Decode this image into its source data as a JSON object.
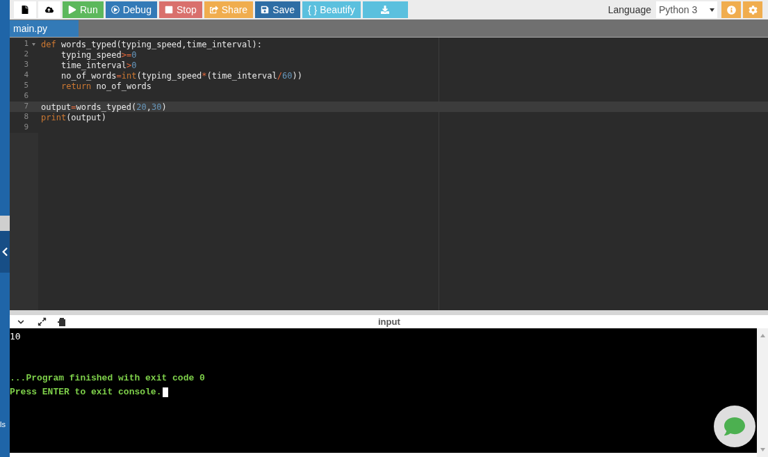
{
  "toolbar": {
    "buttons": [
      {
        "kind": "new-file",
        "color": "#ffffff"
      },
      {
        "kind": "upload",
        "color": "#ffffff"
      },
      {
        "kind": "run",
        "label": "Run",
        "color": "#5cb85c"
      },
      {
        "kind": "debug",
        "label": "Debug",
        "color": "#337ab7"
      },
      {
        "kind": "stop",
        "label": "Stop",
        "color": "#d9706c"
      },
      {
        "kind": "share",
        "label": "Share",
        "color": "#f0ad4e"
      },
      {
        "kind": "save",
        "label": "Save",
        "color": "#2e6da4"
      },
      {
        "kind": "beautify",
        "label": "{ } Beautify",
        "color": "#5bc0de"
      },
      {
        "kind": "download",
        "color": "#5bc0de"
      }
    ],
    "language_label": "Language",
    "language": "Python 3"
  },
  "tabs": [
    {
      "label": "main.py",
      "selected": true
    }
  ],
  "sidebar": {
    "text": "ls"
  },
  "editor": {
    "lines": [
      {
        "number": "1",
        "fold": true,
        "active": false,
        "indent": false,
        "tokens": [
          {
            "kind": "keyword",
            "text": "def"
          },
          {
            "kind": "plain",
            "text": " words_typed(typing_speed,time_interval):"
          }
        ]
      },
      {
        "number": "2",
        "fold": false,
        "active": false,
        "indent": true,
        "tokens": [
          {
            "kind": "plain",
            "text": "typing_speed"
          },
          {
            "kind": "operator",
            "text": ">="
          },
          {
            "kind": "number",
            "text": "0"
          }
        ]
      },
      {
        "number": "3",
        "fold": false,
        "active": false,
        "indent": true,
        "tokens": [
          {
            "kind": "plain",
            "text": "time_interval"
          },
          {
            "kind": "operator",
            "text": ">"
          },
          {
            "kind": "number",
            "text": "0"
          }
        ]
      },
      {
        "number": "4",
        "fold": false,
        "active": false,
        "indent": true,
        "tokens": [
          {
            "kind": "plain",
            "text": "no_of_words"
          },
          {
            "kind": "operator",
            "text": "="
          },
          {
            "kind": "keyword",
            "text": "int"
          },
          {
            "kind": "plain",
            "text": "(typing_speed"
          },
          {
            "kind": "operator",
            "text": "*"
          },
          {
            "kind": "plain",
            "text": "(time_interval"
          },
          {
            "kind": "operator",
            "text": "/"
          },
          {
            "kind": "number",
            "text": "60"
          },
          {
            "kind": "plain",
            "text": "))"
          }
        ]
      },
      {
        "number": "5",
        "fold": false,
        "active": false,
        "indent": true,
        "tokens": [
          {
            "kind": "keyword",
            "text": "return"
          },
          {
            "kind": "plain",
            "text": " no_of_words"
          }
        ]
      },
      {
        "number": "6",
        "fold": false,
        "active": false
      },
      {
        "number": "7",
        "fold": false,
        "active": true,
        "indent": false,
        "tokens": [
          {
            "kind": "plain",
            "text": "output"
          },
          {
            "kind": "operator",
            "text": "="
          },
          {
            "kind": "plain",
            "text": "words_typed("
          },
          {
            "kind": "number",
            "text": "20"
          },
          {
            "kind": "plain",
            "text": ","
          },
          {
            "kind": "number",
            "text": "30"
          },
          {
            "kind": "plain",
            "text": ")"
          }
        ]
      },
      {
        "number": "8",
        "fold": false,
        "active": false,
        "indent": false,
        "tokens": [
          {
            "kind": "keyword",
            "text": "print"
          },
          {
            "kind": "plain",
            "text": "(output)"
          }
        ]
      },
      {
        "number": "9",
        "fold": false,
        "active": false
      }
    ]
  },
  "console": {
    "title": "input",
    "lines": [
      {
        "kind": "output",
        "text": "10"
      },
      {
        "kind": "blank"
      },
      {
        "kind": "blank"
      },
      {
        "kind": "status",
        "text": "...Program finished with exit code 0"
      },
      {
        "kind": "prompt",
        "text": "Press ENTER to exit console."
      }
    ]
  }
}
